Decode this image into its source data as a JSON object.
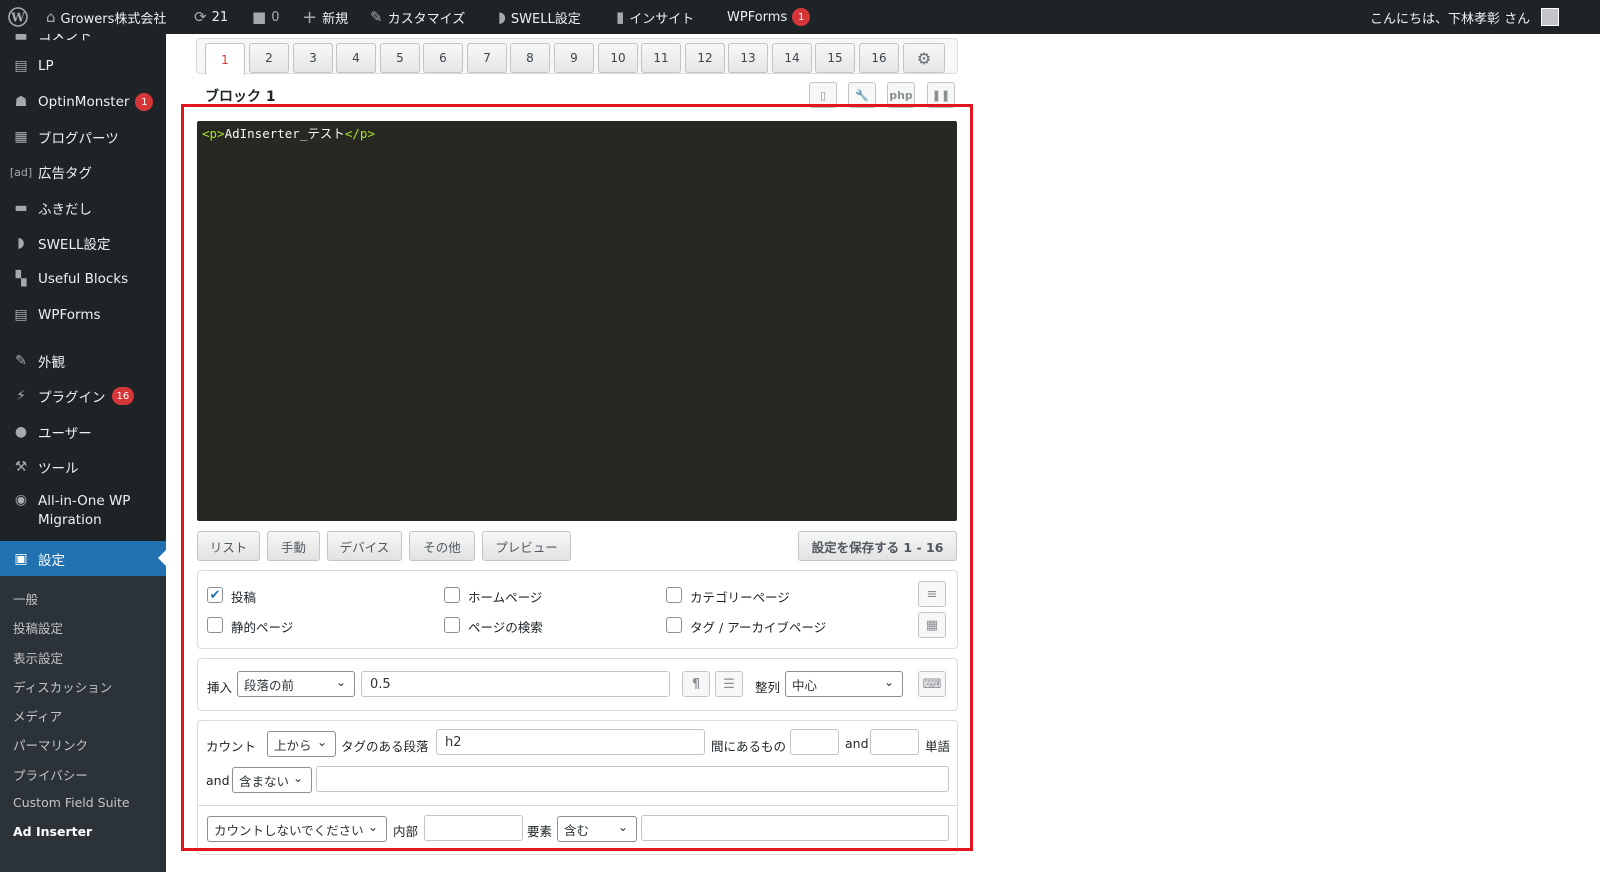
{
  "adminbar": {
    "site_name": "Growers株式会社",
    "updates_count": "21",
    "comments_count": "0",
    "new_label": "新規",
    "customize_label": "カスタマイズ",
    "swell_label": "SWELL設定",
    "insight_label": "インサイト",
    "wpforms_label": "WPForms",
    "wpforms_badge": "1",
    "greeting": "こんにちは、下林孝彰 さん"
  },
  "sidebar": {
    "top_partial": "コメント",
    "items": [
      {
        "label": "LP",
        "icon": "page-icon"
      },
      {
        "label": "OptinMonster",
        "icon": "monster-icon",
        "badge": "1"
      },
      {
        "label": "ブログパーツ",
        "icon": "layout-icon"
      },
      {
        "label": "広告タグ",
        "icon": "ad-icon",
        "icon_text": "[ad]"
      },
      {
        "label": "ふきだし",
        "icon": "balloon-icon"
      },
      {
        "label": "SWELL設定",
        "icon": "swell-icon"
      },
      {
        "label": "Useful Blocks",
        "icon": "blocks-icon"
      },
      {
        "label": "WPForms",
        "icon": "form-icon"
      },
      {
        "label": "外観",
        "icon": "brush-icon"
      },
      {
        "label": "プラグイン",
        "icon": "plugin-icon",
        "badge": "16"
      },
      {
        "label": "ユーザー",
        "icon": "user-icon"
      },
      {
        "label": "ツール",
        "icon": "wrench-icon"
      },
      {
        "label": "All-in-One WP Migration",
        "icon": "migration-icon"
      },
      {
        "label": "設定",
        "icon": "settings-icon"
      }
    ],
    "submenu": [
      "一般",
      "投稿設定",
      "表示設定",
      "ディスカッション",
      "メディア",
      "パーマリンク",
      "プライバシー",
      "Custom Field Suite",
      "Ad Inserter"
    ]
  },
  "tabs": [
    "1",
    "2",
    "3",
    "4",
    "5",
    "6",
    "7",
    "8",
    "9",
    "10",
    "11",
    "12",
    "13",
    "14",
    "15",
    "16"
  ],
  "block_title": "ブロック 1",
  "toolbar": {
    "php_label": "php"
  },
  "editor": {
    "code_open": "<p>",
    "code_text": "AdInserter_テスト",
    "code_close": "</p>"
  },
  "buttons": {
    "list": "リスト",
    "manual": "手動",
    "device": "デバイス",
    "other": "その他",
    "preview": "プレビュー",
    "save": "設定を保存する 1 - 16"
  },
  "checkboxes": [
    {
      "label": "投稿",
      "checked": true
    },
    {
      "label": "ホームページ",
      "checked": false
    },
    {
      "label": "カテゴリーページ",
      "checked": false
    },
    {
      "label": "静的ページ",
      "checked": false
    },
    {
      "label": "ページの検索",
      "checked": false
    },
    {
      "label": "タグ / アーカイブページ",
      "checked": false
    }
  ],
  "insertion": {
    "insert_label": "挿入",
    "insert_value": "段落の前",
    "paragraph_value": "0.5",
    "align_label": "整列",
    "align_value": "中心"
  },
  "counting": {
    "count_label": "カウント",
    "direction_value": "上から",
    "tag_label": "タグのある段落",
    "tag_value": "h2",
    "between_label": "間にあるもの",
    "and_label": "and",
    "words_label": "単語",
    "and2_label": "and",
    "contains_value": "含まない",
    "nocount_value": "カウントしないでください",
    "inside_label": "内部",
    "element_label": "要素",
    "include_value": "含む"
  },
  "colors": {
    "highlight": "#e1161e",
    "accent": "#2271b1",
    "badge": "#d63638"
  }
}
